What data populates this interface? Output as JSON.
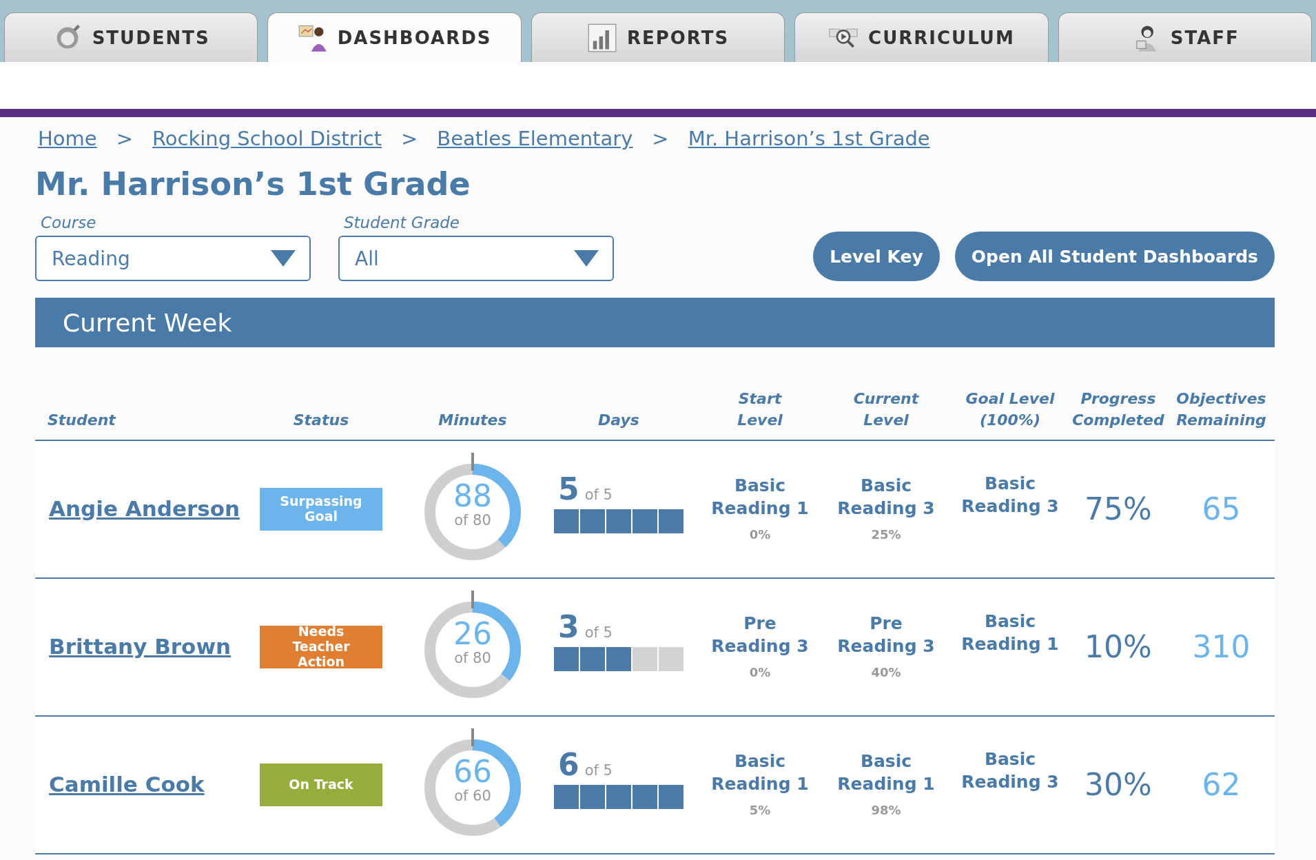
{
  "tabs": [
    {
      "label": "STUDENTS",
      "selected": false
    },
    {
      "label": "DASHBOARDS",
      "selected": true
    },
    {
      "label": "REPORTS",
      "selected": false
    },
    {
      "label": "CURRICULUM",
      "selected": false
    },
    {
      "label": "STAFF",
      "selected": false
    }
  ],
  "breadcrumb": {
    "separator": ">",
    "items": [
      "Home",
      "Rocking School District",
      "Beatles Elementary",
      "Mr. Harrison’s 1st Grade"
    ]
  },
  "page_title": "Mr. Harrison’s 1st Grade",
  "filters": [
    {
      "label": "Course",
      "value": "Reading"
    },
    {
      "label": "Student Grade",
      "value": "All"
    }
  ],
  "buttons": [
    "Level Key",
    "Open All Student Dashboards"
  ],
  "section_title": "Current Week",
  "table": {
    "columns": [
      "Student",
      "Status",
      "Minutes",
      "Days",
      "Start Level",
      "Current Level",
      "Goal Level (100%)",
      "Progress Completed",
      "Objectives Remaining"
    ],
    "rows": [
      {
        "student": "Angie Anderson",
        "status": "Surpassing Goal",
        "color": "#6cb4ec",
        "minutes": "88",
        "minutes_of": "of 80",
        "level": 0.38,
        "days": "5",
        "days_of": "of 5",
        "day_blocks": [
          true,
          true,
          true,
          true,
          true
        ],
        "start_level": "Basic Reading 1",
        "start_pct": "0%",
        "current_level": "Basic Reading 3",
        "current_pct": "25%",
        "goal_level": "Basic Reading 3",
        "progress": "75%",
        "objectives": "65"
      },
      {
        "student": "Brittany Brown",
        "status": "Needs Teacher Action",
        "color": "#e07f32",
        "minutes": "26",
        "minutes_of": "of 80",
        "level": 0.36,
        "days": "3",
        "days_of": "of 5",
        "day_blocks": [
          true,
          true,
          true,
          false,
          false
        ],
        "start_level": "Pre Reading 3",
        "start_pct": "0%",
        "current_level": "Pre Reading 3",
        "current_pct": "40%",
        "goal_level": "Basic Reading 1",
        "progress": "10%",
        "objectives": "310"
      },
      {
        "student": "Camille Cook",
        "status": "On Track",
        "color": "#97ad3b",
        "minutes": "66",
        "minutes_of": "of 60",
        "level": 0.4,
        "days": "6",
        "days_of": "of 5",
        "day_blocks": [
          true,
          true,
          true,
          true,
          true
        ],
        "start_level": "Basic Reading 1",
        "start_pct": "5%",
        "current_level": "Basic Reading 1",
        "current_pct": "98%",
        "goal_level": "Basic Reading 3",
        "progress": "30%",
        "objectives": "62"
      }
    ]
  }
}
